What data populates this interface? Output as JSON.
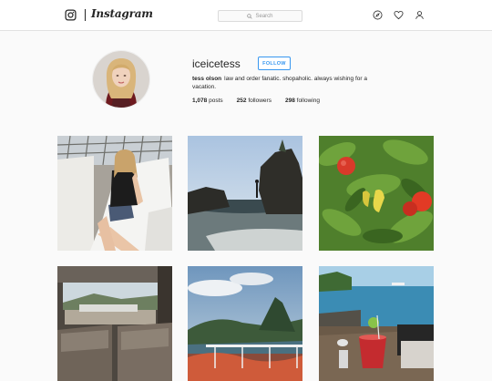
{
  "header": {
    "brand": "Instagram",
    "search_placeholder": "Search",
    "icons": [
      "instagram-logo-icon",
      "search-icon",
      "compass-icon",
      "heart-icon",
      "profile-icon"
    ]
  },
  "profile": {
    "username": "iceicetess",
    "follow_label": "FOLLOW",
    "full_name": "tess olson",
    "bio": "law and order fanatic. shopaholic. always wishing for a vacation.",
    "stats": [
      {
        "number": "1,078",
        "label": "posts"
      },
      {
        "number": "252",
        "label": "followers"
      },
      {
        "number": "298",
        "label": "following"
      }
    ]
  },
  "colors": {
    "accent": "#3897f0",
    "text": "#262626",
    "background": "#fafafa"
  }
}
